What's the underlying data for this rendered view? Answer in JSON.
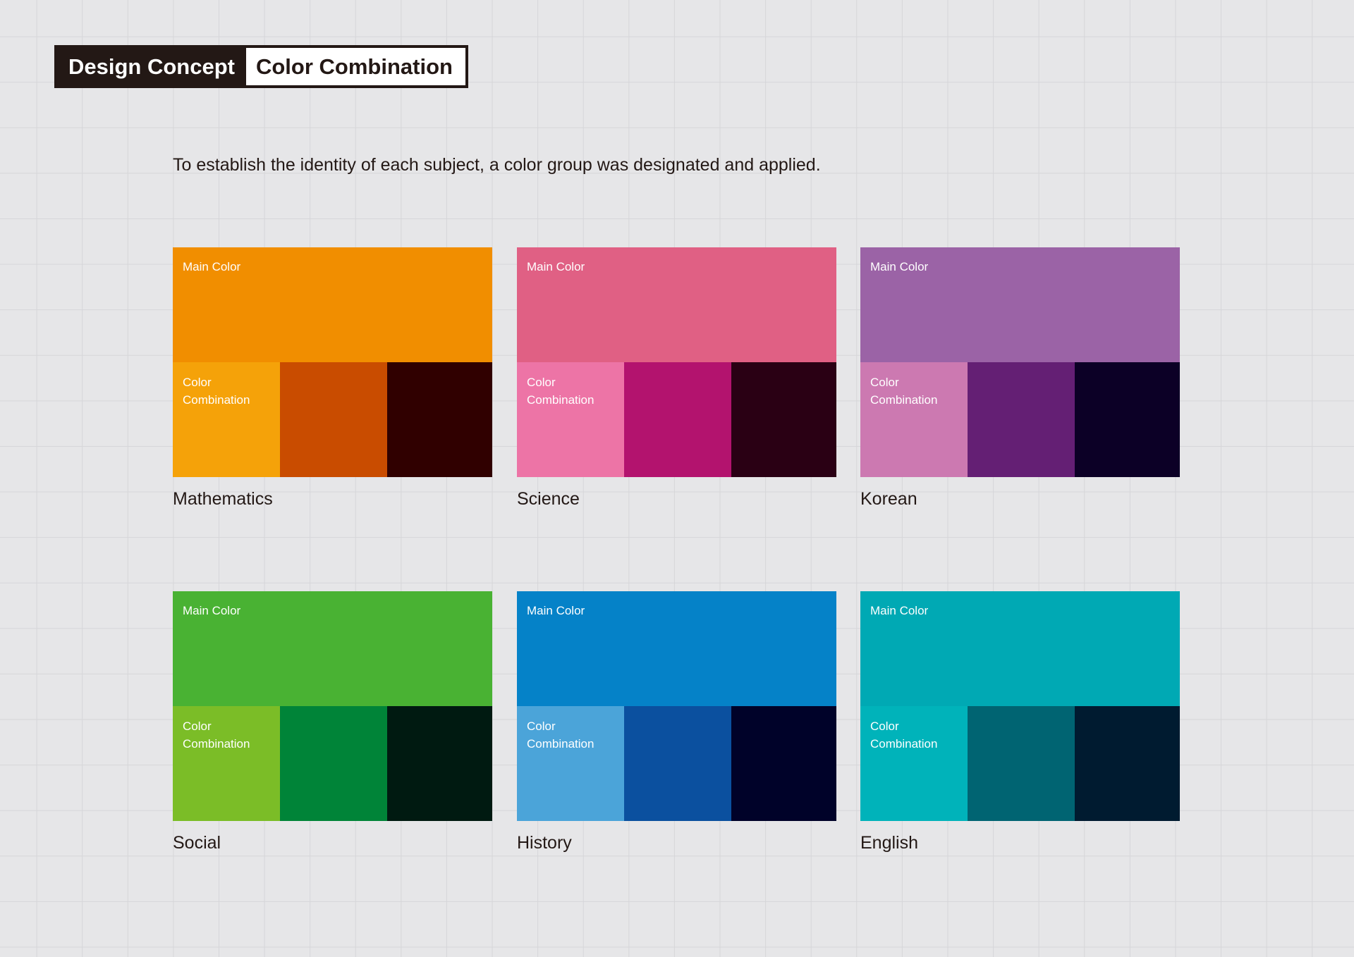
{
  "header": {
    "left_label": "Design Concept",
    "right_label": "Color Combination"
  },
  "intro": "To establish the identity of each subject, a color group was designated and applied.",
  "subjects": [
    {
      "name": "Mathematics",
      "main_label": "Main Color",
      "combo_label": "Color Combination",
      "colors": {
        "main": "#f18e00",
        "c1": "#f5a209",
        "c2": "#c94c00",
        "c3": "#300000"
      }
    },
    {
      "name": "Science",
      "main_label": "Main Color",
      "combo_label": "Color Combination",
      "colors": {
        "main": "#e06084",
        "c1": "#ed74a6",
        "c2": "#b3136e",
        "c3": "#2a0014"
      }
    },
    {
      "name": "Korean",
      "main_label": "Main Color",
      "combo_label": "Color Combination",
      "colors": {
        "main": "#9b63a6",
        "c1": "#cc79b1",
        "c2": "#641f74",
        "c3": "#0c0026"
      }
    },
    {
      "name": "Social",
      "main_label": "Main Color",
      "combo_label": "Color Combination",
      "colors": {
        "main": "#49b233",
        "c1": "#7bbd27",
        "c2": "#008438",
        "c3": "#001a11"
      }
    },
    {
      "name": "History",
      "main_label": "Main Color",
      "combo_label": "Color Combination",
      "colors": {
        "main": "#0582c8",
        "c1": "#4ba4d9",
        "c2": "#0b509f",
        "c3": "#000229"
      }
    },
    {
      "name": "English",
      "main_label": "Main Color",
      "combo_label": "Color Combination",
      "colors": {
        "main": "#00a9b4",
        "c1": "#00b3ba",
        "c2": "#006472",
        "c3": "#001b30"
      }
    }
  ]
}
